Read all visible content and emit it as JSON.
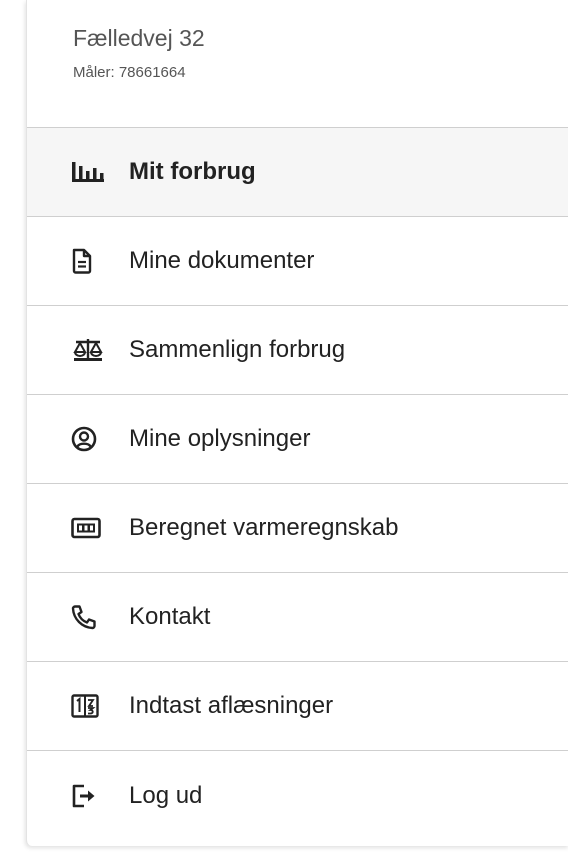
{
  "address": {
    "street": "Fælledvej 32",
    "meter": "Måler: 78661664"
  },
  "menu": {
    "items": [
      {
        "label": "Mit forbrug",
        "icon": "bar-chart-icon",
        "active": true
      },
      {
        "label": "Mine dokumenter",
        "icon": "document-icon",
        "active": false
      },
      {
        "label": "Sammenlign forbrug",
        "icon": "scales-icon",
        "active": false
      },
      {
        "label": "Mine oplysninger",
        "icon": "user-circle-icon",
        "active": false
      },
      {
        "label": "Beregnet varmeregnskab",
        "icon": "meter-display-icon",
        "active": false
      },
      {
        "label": "Kontakt",
        "icon": "phone-icon",
        "active": false
      },
      {
        "label": "Indtast aflæsninger",
        "icon": "number-keypad-icon",
        "active": false
      },
      {
        "label": "Log ud",
        "icon": "logout-icon",
        "active": false
      }
    ]
  },
  "colors": {
    "text": "#222222",
    "muted": "#555555",
    "divider": "#cfcfcf",
    "active_bg": "#f6f6f6"
  }
}
